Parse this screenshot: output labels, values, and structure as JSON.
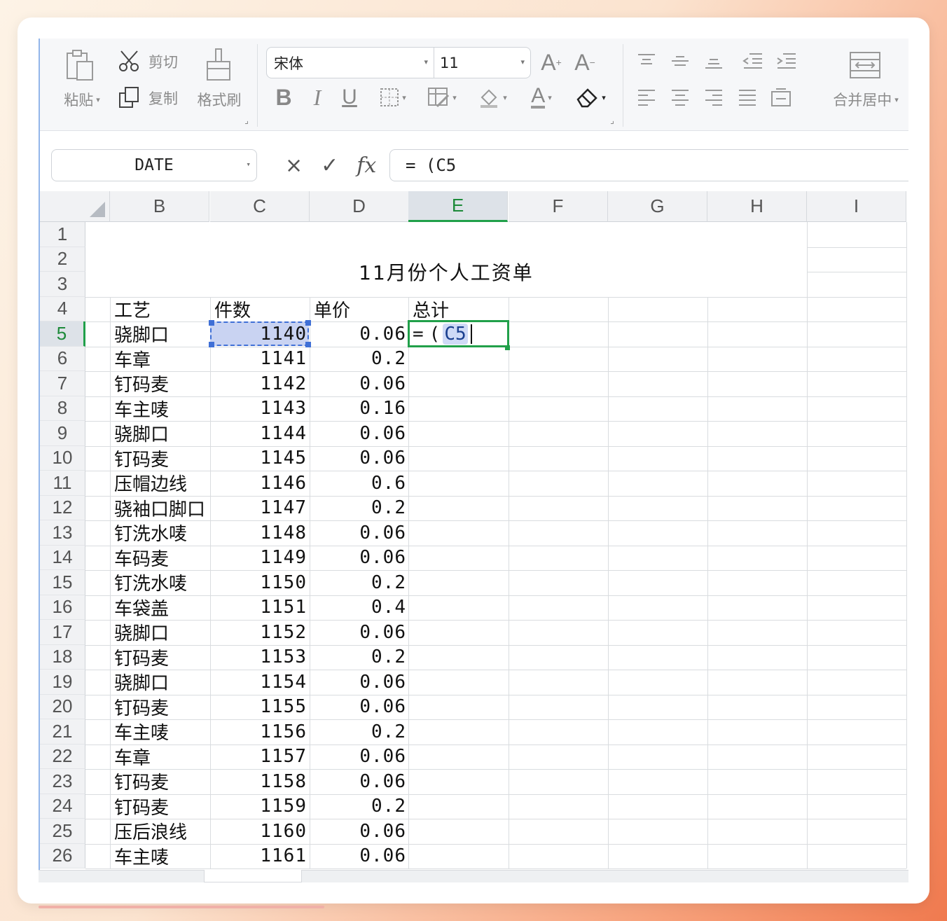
{
  "ribbon": {
    "paste_label": "粘贴",
    "cut_label": "剪切",
    "copy_label": "复制",
    "format_painter_label": "格式刷",
    "font_name": "宋体",
    "font_size": "11",
    "merge_center_label": "合并居中"
  },
  "formula_bar": {
    "name_box": "DATE",
    "cancel_symbol": "×",
    "confirm_symbol": "✓",
    "fx_label": "fx",
    "formula": "= (C5"
  },
  "columns": [
    "B",
    "C",
    "D",
    "E",
    "F",
    "G",
    "H",
    "I"
  ],
  "active_column": "E",
  "rows": [
    "1",
    "2",
    "3",
    "4",
    "5",
    "6",
    "7",
    "8",
    "9",
    "10",
    "11",
    "12",
    "13",
    "14",
    "15",
    "16",
    "17",
    "18",
    "19",
    "20",
    "21",
    "22",
    "23",
    "24",
    "25",
    "26"
  ],
  "active_row": "5",
  "sheet": {
    "title": "11月份个人工资单",
    "headers": {
      "b": "工艺",
      "c": "件数",
      "d": "单价",
      "e": "总计"
    },
    "data": [
      {
        "b": "骁脚口",
        "c": "1140",
        "d": "0.06"
      },
      {
        "b": "车章",
        "c": "1141",
        "d": "0.2"
      },
      {
        "b": "钉码麦",
        "c": "1142",
        "d": "0.06"
      },
      {
        "b": "车主唛",
        "c": "1143",
        "d": "0.16"
      },
      {
        "b": "骁脚口",
        "c": "1144",
        "d": "0.06"
      },
      {
        "b": "钉码麦",
        "c": "1145",
        "d": "0.06"
      },
      {
        "b": "压帽边线",
        "c": "1146",
        "d": "0.6"
      },
      {
        "b": "骁袖口脚口",
        "c": "1147",
        "d": "0.2"
      },
      {
        "b": "钉洗水唛",
        "c": "1148",
        "d": "0.06"
      },
      {
        "b": "车码麦",
        "c": "1149",
        "d": "0.06"
      },
      {
        "b": "钉洗水唛",
        "c": "1150",
        "d": "0.2"
      },
      {
        "b": "车袋盖",
        "c": "1151",
        "d": "0.4"
      },
      {
        "b": "骁脚口",
        "c": "1152",
        "d": "0.06"
      },
      {
        "b": "钉码麦",
        "c": "1153",
        "d": "0.2"
      },
      {
        "b": "骁脚口",
        "c": "1154",
        "d": "0.06"
      },
      {
        "b": "钉码麦",
        "c": "1155",
        "d": "0.06"
      },
      {
        "b": "车主唛",
        "c": "1156",
        "d": "0.2"
      },
      {
        "b": "车章",
        "c": "1157",
        "d": "0.06"
      },
      {
        "b": "钉码麦",
        "c": "1158",
        "d": "0.06"
      },
      {
        "b": "钉码麦",
        "c": "1159",
        "d": "0.2"
      },
      {
        "b": "压后浪线",
        "c": "1160",
        "d": "0.06"
      },
      {
        "b": "车主唛",
        "c": "1161",
        "d": "0.06"
      }
    ],
    "editing_cell": {
      "eq": "=",
      "paren": "(",
      "ref": "C5"
    }
  },
  "colors": {
    "active_green": "#21a04a",
    "selection_blue": "#3f6fd6"
  }
}
